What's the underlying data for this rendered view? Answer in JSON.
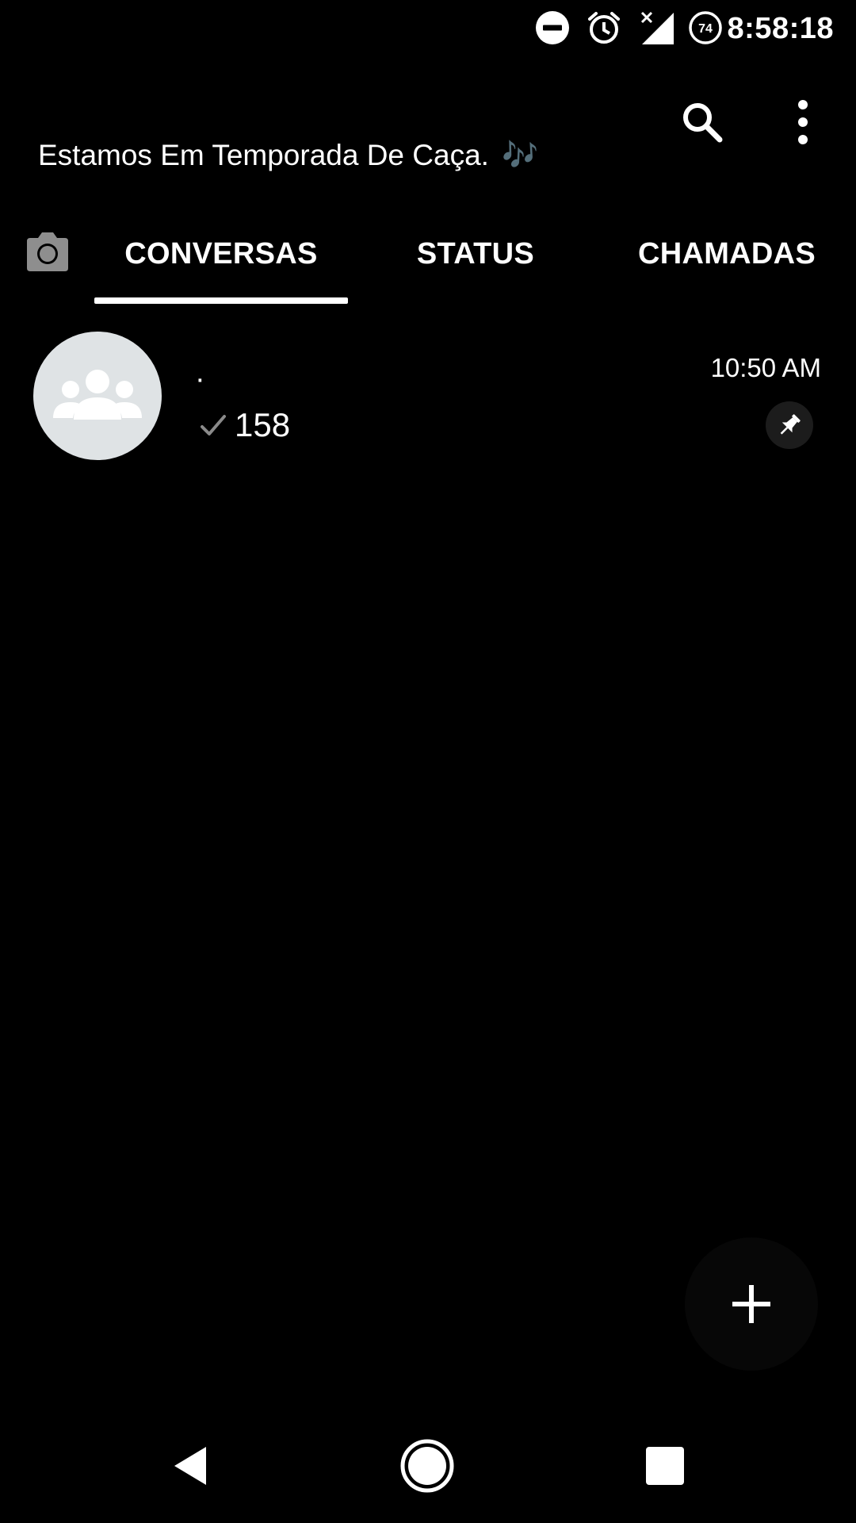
{
  "status_bar": {
    "time": "8:58:18",
    "battery_level": "74",
    "icons": [
      "do-not-disturb-icon",
      "alarm-icon",
      "no-signal-icon",
      "battery-saver-icon"
    ]
  },
  "header": {
    "title": "Estamos Em Temporada De Caça.",
    "title_suffix": "🎶",
    "actions": [
      "search-icon",
      "more-options-icon"
    ]
  },
  "tabs": {
    "camera_icon": "camera-icon",
    "items": [
      {
        "label": "CONVERSAS",
        "selected": true
      },
      {
        "label": "STATUS",
        "selected": false
      },
      {
        "label": "CHAMADAS",
        "selected": false
      }
    ]
  },
  "chats": [
    {
      "name": "·",
      "time": "10:50 AM",
      "preview": "158",
      "status_icon": "single-check-icon",
      "pinned": true,
      "avatar": "group-avatar-icon"
    }
  ],
  "fab": {
    "icon": "plus-icon"
  },
  "nav_bar": {
    "icons": [
      "back-icon",
      "home-icon",
      "recents-icon"
    ]
  },
  "colors": {
    "background": "#000000",
    "text": "#ffffff",
    "avatar_bg": "#dfe3e5",
    "check": "#8a8a8a",
    "camera": "#8e8e8e"
  }
}
